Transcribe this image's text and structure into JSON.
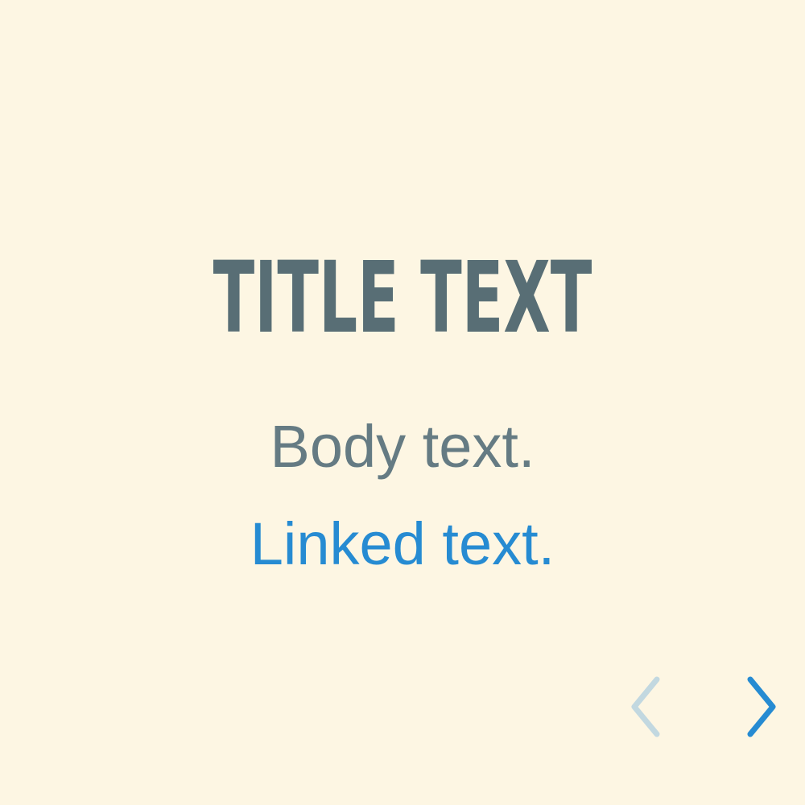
{
  "slide": {
    "title": "TITLE TEXT",
    "body": "Body text.",
    "link": "Linked text."
  },
  "navigation": {
    "prev_icon": "chevron-left-icon",
    "next_icon": "chevron-right-icon",
    "prev_enabled": false,
    "next_enabled": true
  },
  "colors": {
    "background": "#fdf6e3",
    "title": "#586e75",
    "body": "#657b83",
    "link": "#268bd2",
    "nav_active": "#268bd2",
    "nav_disabled": "#c2d8e0"
  }
}
